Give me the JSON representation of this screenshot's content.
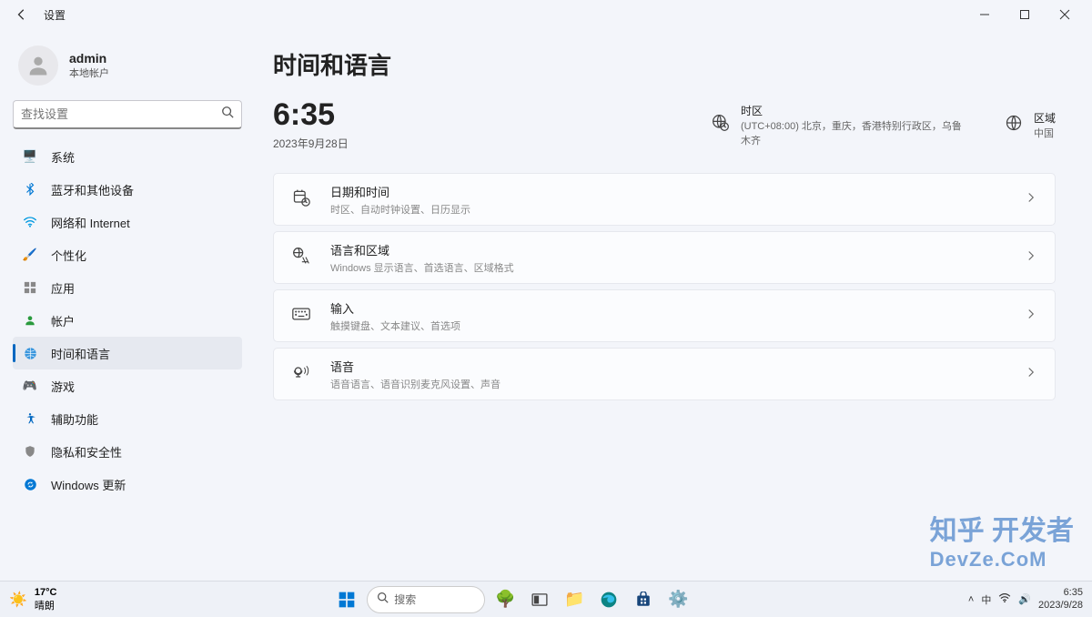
{
  "titlebar": {
    "title": "设置"
  },
  "user": {
    "name": "admin",
    "sub": "本地帐户"
  },
  "search": {
    "placeholder": "查找设置"
  },
  "nav": [
    {
      "label": "系统",
      "icon": "🖥️"
    },
    {
      "label": "蓝牙和其他设备",
      "icon": "bluetooth"
    },
    {
      "label": "网络和 Internet",
      "icon": "wifi"
    },
    {
      "label": "个性化",
      "icon": "🖌️"
    },
    {
      "label": "应用",
      "icon": "📦"
    },
    {
      "label": "帐户",
      "icon": "👤"
    },
    {
      "label": "时间和语言",
      "icon": "🌐"
    },
    {
      "label": "游戏",
      "icon": "🎮"
    },
    {
      "label": "辅助功能",
      "icon": "accessibility"
    },
    {
      "label": "隐私和安全性",
      "icon": "🛡️"
    },
    {
      "label": "Windows 更新",
      "icon": "🔄"
    }
  ],
  "page": {
    "title": "时间和语言",
    "time": "6:35",
    "date": "2023年9月28日",
    "timezone": {
      "label": "时区",
      "value": "(UTC+08:00) 北京，重庆，香港特别行政区，乌鲁木齐"
    },
    "region": {
      "label": "区域",
      "value": "中国"
    }
  },
  "cards": [
    {
      "title": "日期和时间",
      "sub": "时区、自动时钟设置、日历显示",
      "icon": "clock"
    },
    {
      "title": "语言和区域",
      "sub": "Windows 显示语言、首选语言、区域格式",
      "icon": "lang"
    },
    {
      "title": "输入",
      "sub": "触摸键盘、文本建议、首选项",
      "icon": "keyboard"
    },
    {
      "title": "语音",
      "sub": "语音语言、语音识别麦克风设置、声音",
      "icon": "mic"
    }
  ],
  "taskbar": {
    "weather": {
      "temp": "17°C",
      "desc": "晴朗"
    },
    "search": "搜索",
    "tray": {
      "time": "6:35",
      "date": "2023/9/28"
    }
  },
  "watermark": {
    "line1": "知乎 开发者",
    "line2": "DevZe.CoM"
  }
}
